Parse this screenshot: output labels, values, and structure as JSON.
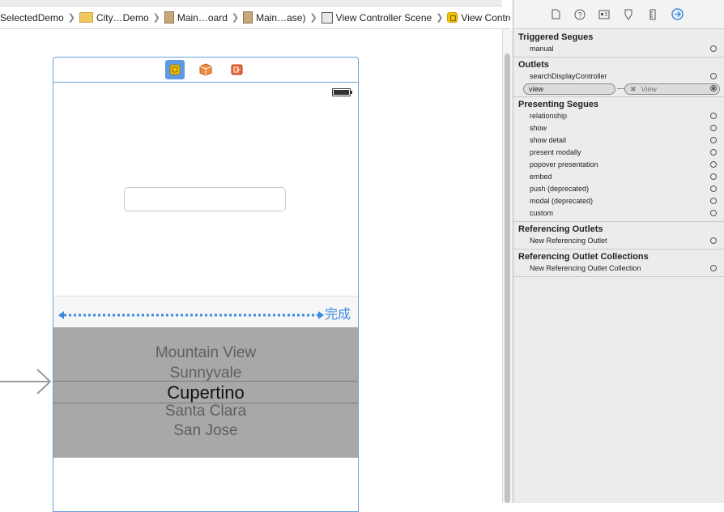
{
  "breadcrumb": {
    "items": [
      {
        "label": "SelectedDemo",
        "icon": "project-icon"
      },
      {
        "label": "City…Demo",
        "icon": "folder-icon"
      },
      {
        "label": "Main…oard",
        "icon": "storyboard-file-icon"
      },
      {
        "label": "Main…ase)",
        "icon": "storyboard-file-icon"
      },
      {
        "label": "View Controller Scene",
        "icon": "scene-icon"
      },
      {
        "label": "View Controller",
        "icon": "view-controller-icon"
      }
    ]
  },
  "scene": {
    "done_label": "完成",
    "picker_rows": [
      "Mountain View",
      "Sunnyvale",
      "Cupertino",
      "Santa Clara",
      "San Jose"
    ],
    "selected_row": "Cupertino"
  },
  "inspector": {
    "tabs": [
      "file-icon",
      "help-icon",
      "identity-icon",
      "attributes-icon",
      "size-icon",
      "connections-icon"
    ],
    "active_tab": "connections-icon",
    "sections": {
      "triggered_segues": {
        "title": "Triggered Segues",
        "rows": [
          "manual"
        ]
      },
      "outlets": {
        "title": "Outlets",
        "rows": [
          "searchDisplayController",
          "view"
        ],
        "connected": {
          "source": "view",
          "target": "View"
        }
      },
      "presenting_segues": {
        "title": "Presenting Segues",
        "rows": [
          "relationship",
          "show",
          "show detail",
          "present modally",
          "popover presentation",
          "embed",
          "push (deprecated)",
          "modal (deprecated)",
          "custom"
        ]
      },
      "referencing_outlets": {
        "title": "Referencing Outlets",
        "rows": [
          "New Referencing Outlet"
        ]
      },
      "referencing_outlet_collections": {
        "title": "Referencing Outlet Collections",
        "rows": [
          "New Referencing Outlet Collection"
        ]
      }
    }
  },
  "colors": {
    "accent": "#3b8ae4",
    "picker_bg": "#a8a8a8",
    "scene_border": "#6ca0d8"
  }
}
